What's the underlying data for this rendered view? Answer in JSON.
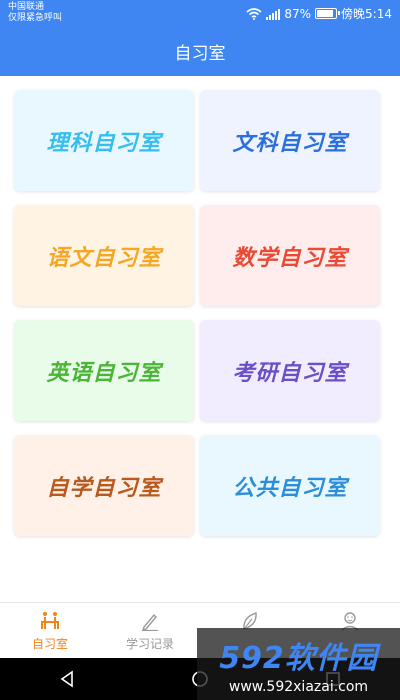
{
  "status_bar": {
    "carrier_line1": "中国联通",
    "carrier_line2": "仅限紧急呼叫",
    "battery": "87%",
    "time": "傍晚5:14"
  },
  "header": {
    "title": "自习室"
  },
  "rooms": [
    {
      "label": "理科自习室",
      "bg": "#e9f8ff",
      "color": "#35bff0"
    },
    {
      "label": "文科自习室",
      "bg": "#eef3ff",
      "color": "#2b6fdc"
    },
    {
      "label": "语文自习室",
      "bg": "#fff3e3",
      "color": "#f5a623"
    },
    {
      "label": "数学自习室",
      "bg": "#ffecec",
      "color": "#e84a33"
    },
    {
      "label": "英语自习室",
      "bg": "#e9fbe9",
      "color": "#4bb538"
    },
    {
      "label": "考研自习室",
      "bg": "#f1edff",
      "color": "#6a4fc8"
    },
    {
      "label": "自学自习室",
      "bg": "#fff0e8",
      "color": "#b85a1d"
    },
    {
      "label": "公共自习室",
      "bg": "#e9f8ff",
      "color": "#2d8ed8"
    }
  ],
  "tabs": [
    {
      "label": "自习室",
      "icon": "study-room-icon",
      "active": true
    },
    {
      "label": "学习记录",
      "icon": "pen-icon",
      "active": false
    },
    {
      "label": "",
      "icon": "leaf-icon",
      "active": false
    },
    {
      "label": "",
      "icon": "user-icon",
      "active": false
    }
  ],
  "watermark": {
    "title": "592软件园",
    "url": "www.592xiazai.com"
  },
  "colors": {
    "primary": "#3f86f2",
    "active_tab": "#f08519",
    "inactive_tab": "#999999"
  }
}
